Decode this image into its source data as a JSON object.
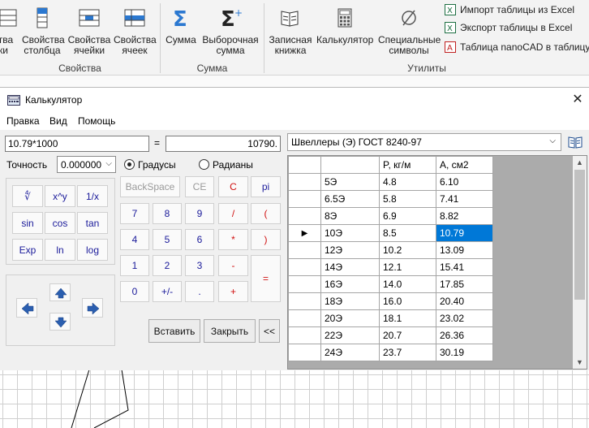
{
  "ribbon": {
    "buttons": [
      {
        "label1": "ства",
        "label2": "ки"
      },
      {
        "label1": "Свойства",
        "label2": "столбца"
      },
      {
        "label1": "Свойства",
        "label2": "ячейки"
      },
      {
        "label1": "Свойства",
        "label2": "ячеек"
      },
      {
        "label1": "Сумма",
        "label2": ""
      },
      {
        "label1": "Выборочная",
        "label2": "сумма"
      },
      {
        "label1": "Записная",
        "label2": "книжка"
      },
      {
        "label1": "Калькулятор",
        "label2": ""
      },
      {
        "label1": "Специальные",
        "label2": "символы"
      }
    ],
    "small_items": [
      "Импорт таблицы из Excel",
      "Экспорт таблицы в Excel",
      "Таблица nanoCAD в таблицу ..."
    ],
    "groups": {
      "properties": "Свойства",
      "sum": "Сумма",
      "utilities": "Утилиты"
    }
  },
  "window": {
    "title": "Калькулятор",
    "close": "✕",
    "menu": [
      "Правка",
      "Вид",
      "Помощь"
    ]
  },
  "calc": {
    "expression": "10.79*1000",
    "equals": "=",
    "result": "10790.",
    "precision_label": "Точность",
    "precision_value": "0.000000",
    "degrees": "Градусы",
    "radians": "Радианы",
    "func_buttons": [
      "∜",
      "x^y",
      "1/x",
      "sin",
      "cos",
      "tan",
      "Exp",
      "ln",
      "log"
    ],
    "top_buttons": [
      "BackSpace",
      "CE",
      "C",
      "pi"
    ],
    "num_buttons": [
      [
        "7",
        "8",
        "9",
        "/",
        "("
      ],
      [
        "4",
        "5",
        "6",
        "*",
        ")"
      ],
      [
        "1",
        "2",
        "3",
        "-",
        "="
      ],
      [
        "0",
        "+/-",
        ".",
        "+"
      ]
    ],
    "insert": "Вставить",
    "close_btn": "Закрыть",
    "collapse": "<<"
  },
  "table": {
    "combo_value": "Швеллеры (Э) ГОСТ 8240-97",
    "columns": [
      "",
      "P, кг/м",
      "A, см2"
    ],
    "rows": [
      [
        "5Э",
        "4.8",
        "6.10"
      ],
      [
        "6.5Э",
        "5.8",
        "7.41"
      ],
      [
        "8Э",
        "6.9",
        "8.82"
      ],
      [
        "10Э",
        "8.5",
        "10.79"
      ],
      [
        "12Э",
        "10.2",
        "13.09"
      ],
      [
        "14Э",
        "12.1",
        "15.41"
      ],
      [
        "16Э",
        "14.0",
        "17.85"
      ],
      [
        "18Э",
        "16.0",
        "20.40"
      ],
      [
        "20Э",
        "18.1",
        "23.02"
      ],
      [
        "22Э",
        "20.7",
        "26.36"
      ],
      [
        "24Э",
        "23.7",
        "30.19"
      ]
    ],
    "current_row_index": 3,
    "selection_color": "#0078d7"
  }
}
